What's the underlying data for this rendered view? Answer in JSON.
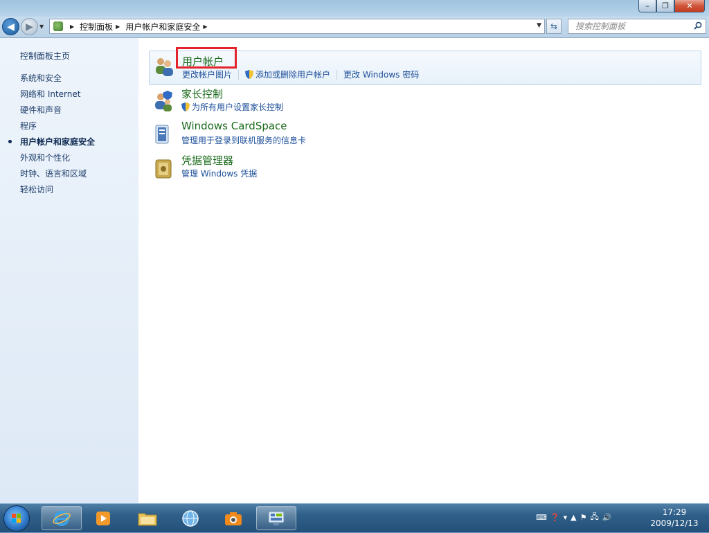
{
  "window": {
    "controls": {
      "minimize": "–",
      "maximize": "❐",
      "close": "✕"
    }
  },
  "address_bar": {
    "breadcrumbs": [
      "控制面板",
      "用户帐户和家庭安全"
    ],
    "search_placeholder": "搜索控制面板"
  },
  "left_pane": {
    "home": "控制面板主页",
    "items": [
      {
        "label": "系统和安全",
        "active": false
      },
      {
        "label": "网络和 Internet",
        "active": false
      },
      {
        "label": "硬件和声音",
        "active": false
      },
      {
        "label": "程序",
        "active": false
      },
      {
        "label": "用户帐户和家庭安全",
        "active": true
      },
      {
        "label": "外观和个性化",
        "active": false
      },
      {
        "label": "时钟、语言和区域",
        "active": false
      },
      {
        "label": "轻松访问",
        "active": false
      }
    ]
  },
  "categories": [
    {
      "title": "用户帐户",
      "icon": "user-accounts-icon",
      "links": [
        "更改帐户图片",
        "添加或删除用户帐户",
        "更改 Windows 密码"
      ]
    },
    {
      "title": "家长控制",
      "icon": "parental-controls-icon",
      "links": [
        "为所有用户设置家长控制"
      ]
    },
    {
      "title": "Windows CardSpace",
      "icon": "cardspace-icon",
      "links": [
        "管理用于登录到联机服务的信息卡"
      ]
    },
    {
      "title": "凭据管理器",
      "icon": "credential-manager-icon",
      "links": [
        "管理 Windows 凭据"
      ]
    }
  ],
  "taskbar": {
    "clock_time": "17:29",
    "clock_date": "2009/12/13"
  },
  "colors": {
    "category_title": "#186a1a",
    "link": "#1d4f9a",
    "highlight_frame": "#e3222b"
  }
}
